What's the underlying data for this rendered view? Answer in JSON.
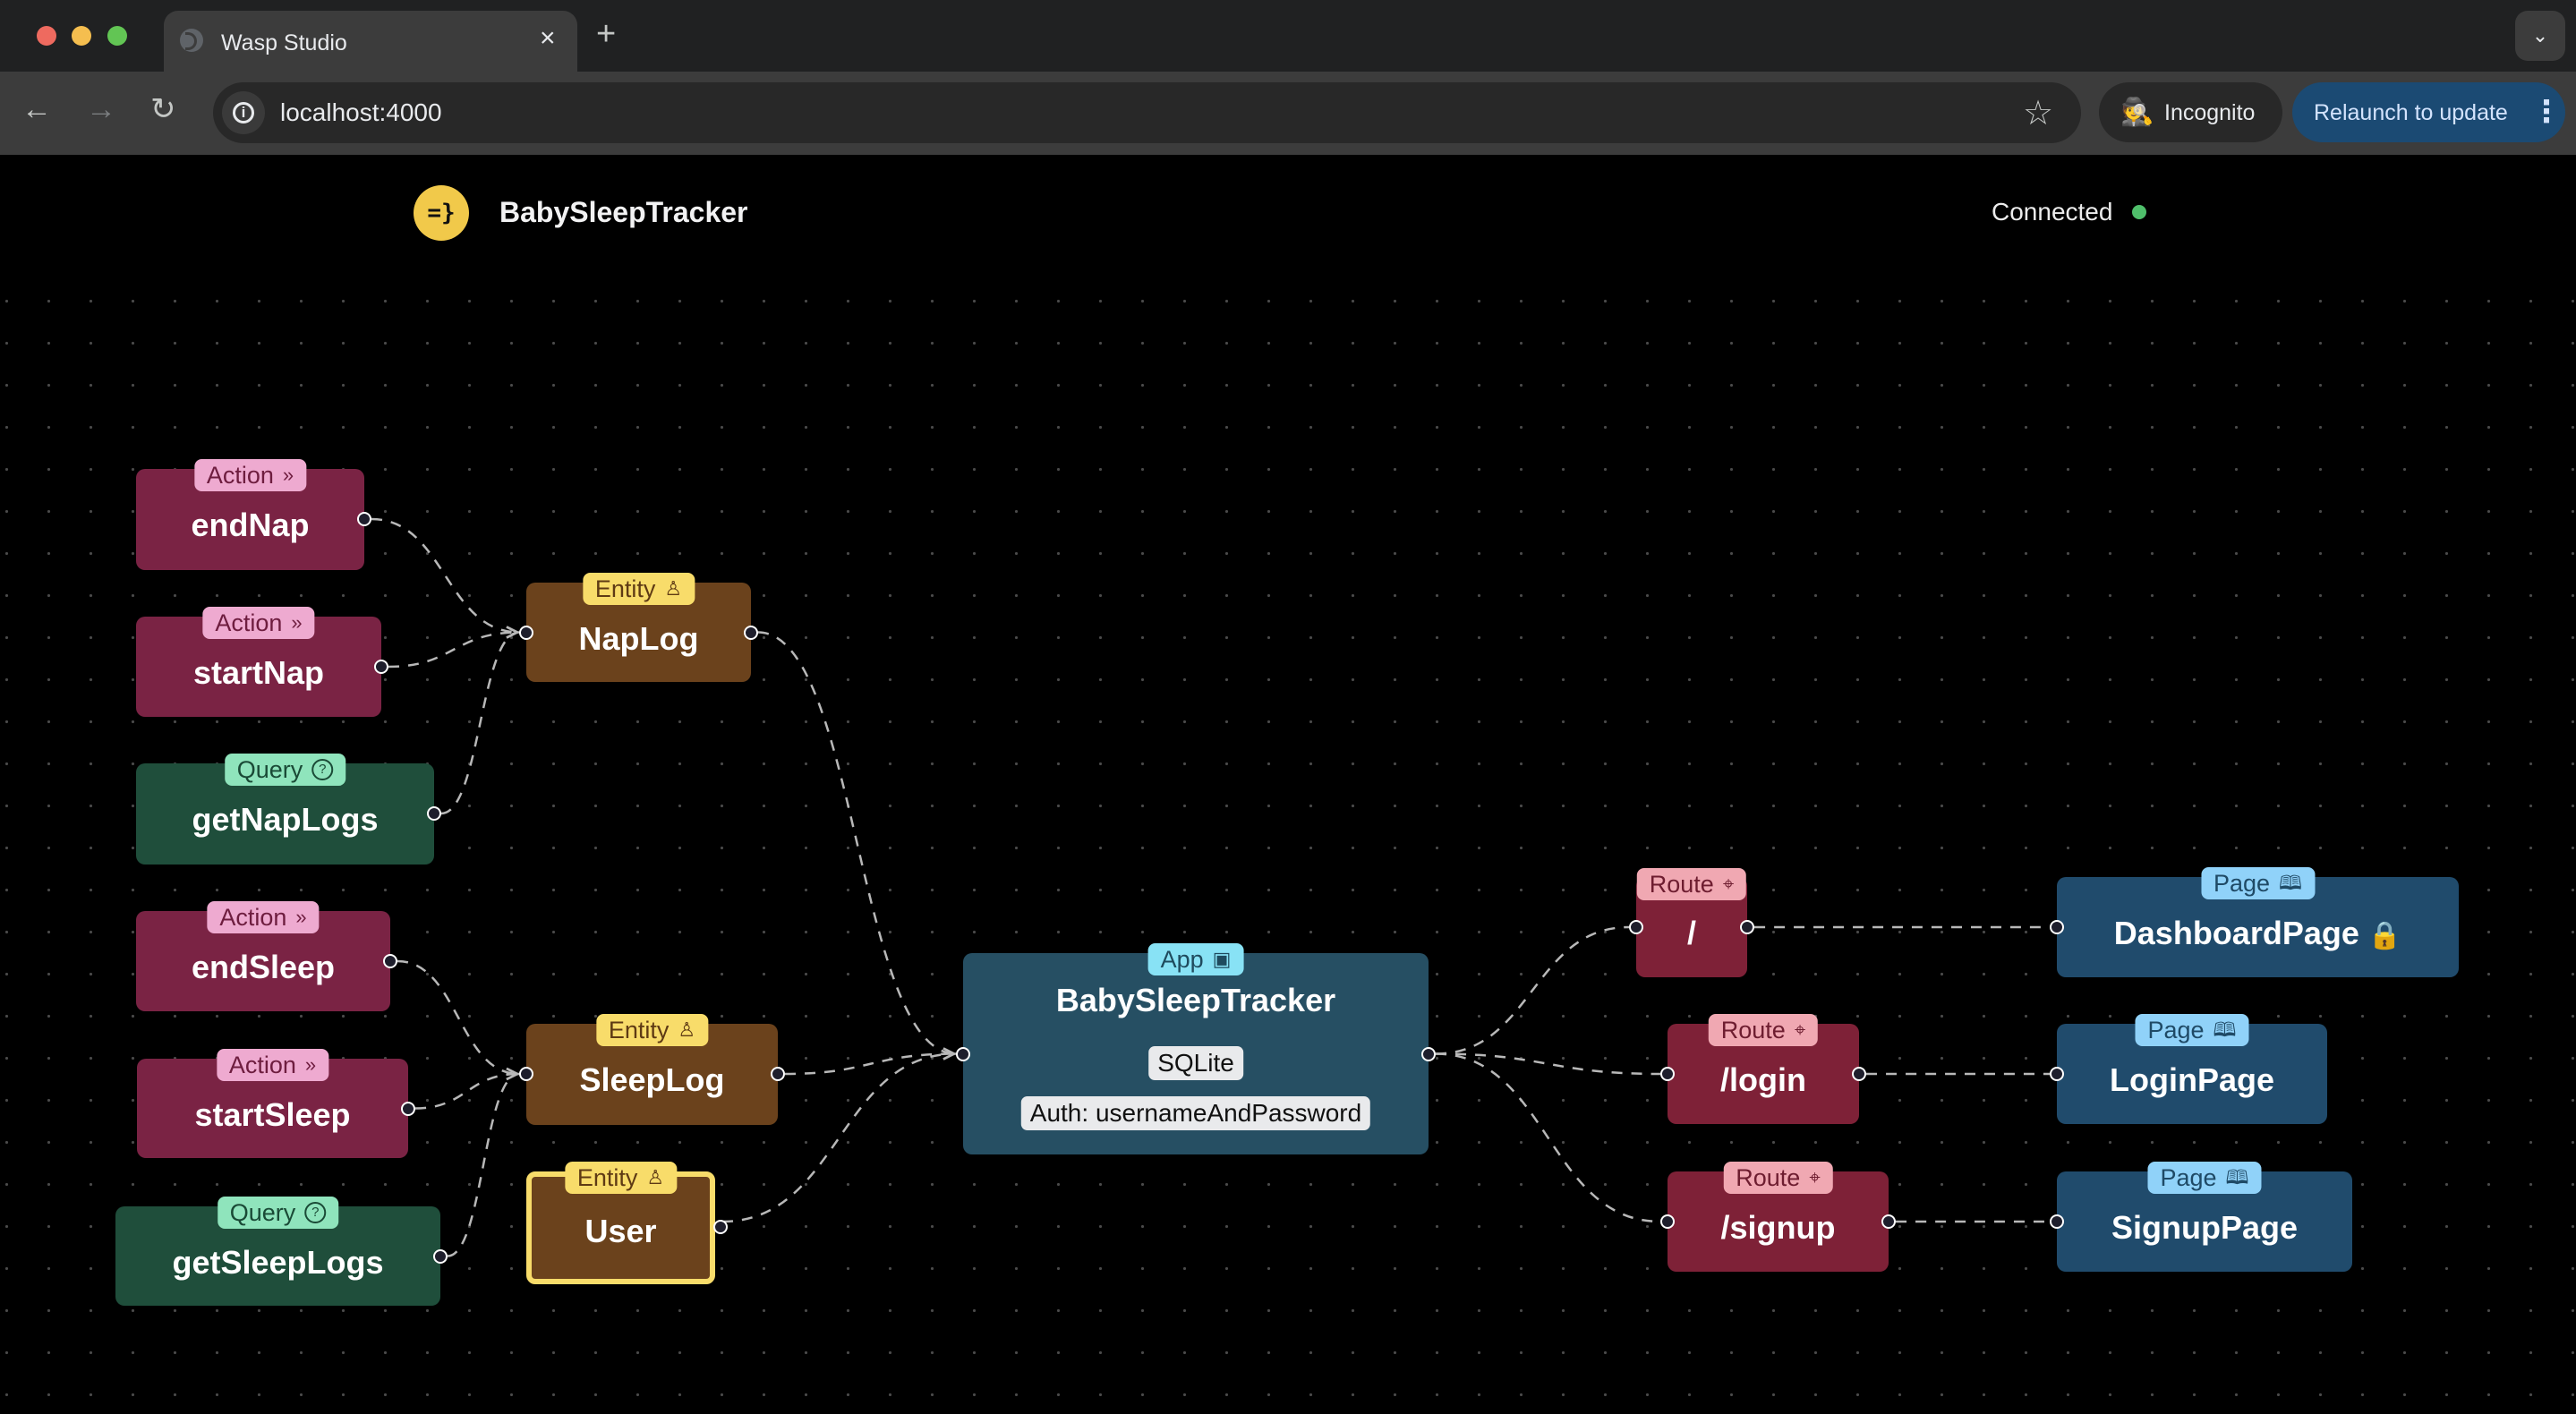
{
  "browser": {
    "tab_title": "Wasp Studio",
    "tab_close_icon": "×",
    "new_tab_icon": "+",
    "tab_list_icon": "⌄",
    "url": "localhost:4000",
    "nav": {
      "back_icon": "←",
      "forward_icon": "→",
      "reload_icon": "↻",
      "info_icon": "i",
      "star_icon": "☆"
    },
    "incognito_label": "Incognito",
    "incognito_icon": "🕵",
    "relaunch_label": "Relaunch to update",
    "menu_icon": "⋮"
  },
  "header": {
    "logo_text": "=}",
    "app_name": "BabySleepTracker",
    "status_label": "Connected",
    "status_color": "#4fbf6b"
  },
  "badges": {
    "action": {
      "label": "Action",
      "icon": "»"
    },
    "query": {
      "label": "Query",
      "icon": "?"
    },
    "entity": {
      "label": "Entity",
      "icon": "♙"
    },
    "app": {
      "label": "App",
      "icon": "▣"
    },
    "route": {
      "label": "Route",
      "icon": "⌖"
    },
    "page": {
      "label": "Page",
      "icon": "🕮"
    }
  },
  "nodes": {
    "endNap": {
      "type": "action",
      "name": "endNap"
    },
    "startNap": {
      "type": "action",
      "name": "startNap"
    },
    "getNapLogs": {
      "type": "query",
      "name": "getNapLogs"
    },
    "endSleep": {
      "type": "action",
      "name": "endSleep"
    },
    "startSleep": {
      "type": "action",
      "name": "startSleep"
    },
    "getSleepLogs": {
      "type": "query",
      "name": "getSleepLogs"
    },
    "NapLog": {
      "type": "entity",
      "name": "NapLog"
    },
    "SleepLog": {
      "type": "entity",
      "name": "SleepLog"
    },
    "User": {
      "type": "entity",
      "name": "User",
      "selected": true
    },
    "app": {
      "type": "app",
      "name": "BabySleepTracker",
      "db": "SQLite",
      "auth": "Auth: usernameAndPassword"
    },
    "routeRoot": {
      "type": "route",
      "name": "/"
    },
    "routeLogin": {
      "type": "route",
      "name": "/login"
    },
    "routeSignup": {
      "type": "route",
      "name": "/signup"
    },
    "DashboardPage": {
      "type": "page",
      "name": "DashboardPage",
      "auth_required": true,
      "lock_icon": "🔒"
    },
    "LoginPage": {
      "type": "page",
      "name": "LoginPage"
    },
    "SignupPage": {
      "type": "page",
      "name": "SignupPage"
    }
  },
  "edges": [
    {
      "from": "endNap",
      "to": "NapLog"
    },
    {
      "from": "startNap",
      "to": "NapLog"
    },
    {
      "from": "getNapLogs",
      "to": "NapLog"
    },
    {
      "from": "endSleep",
      "to": "SleepLog"
    },
    {
      "from": "startSleep",
      "to": "SleepLog"
    },
    {
      "from": "getSleepLogs",
      "to": "SleepLog"
    },
    {
      "from": "NapLog",
      "to": "app"
    },
    {
      "from": "SleepLog",
      "to": "app"
    },
    {
      "from": "User",
      "to": "app"
    },
    {
      "from": "app",
      "to": "routeRoot"
    },
    {
      "from": "app",
      "to": "routeLogin"
    },
    {
      "from": "app",
      "to": "routeSignup"
    },
    {
      "from": "routeRoot",
      "to": "DashboardPage"
    },
    {
      "from": "routeLogin",
      "to": "LoginPage"
    },
    {
      "from": "routeSignup",
      "to": "SignupPage"
    }
  ]
}
